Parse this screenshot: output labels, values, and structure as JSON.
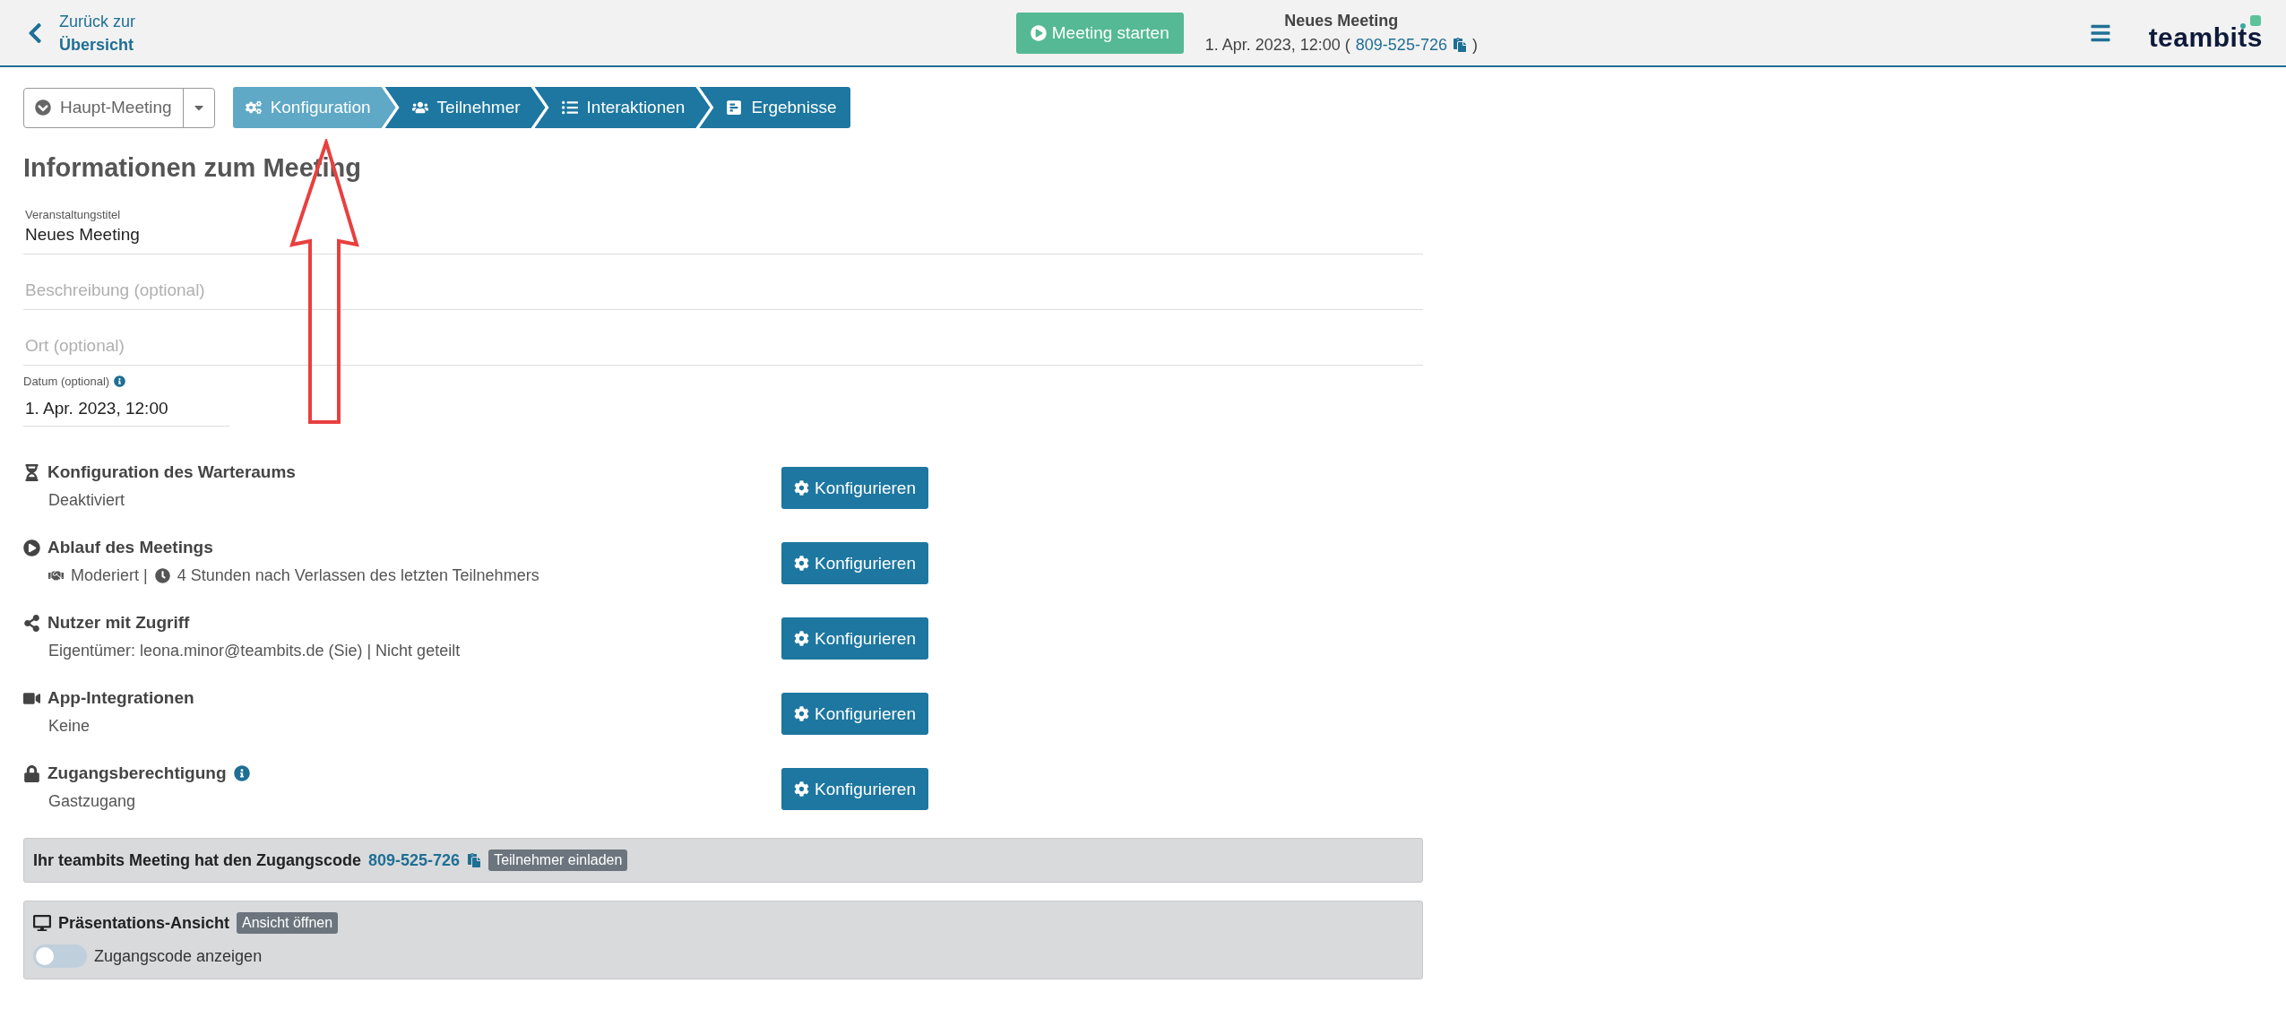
{
  "header": {
    "back_link": {
      "line1": "Zurück zur",
      "line2": "Übersicht"
    },
    "start_button": "Meeting starten",
    "meeting_title": "Neues Meeting",
    "meeting_date": "1. Apr. 2023, 12:00 (",
    "meeting_code": "809-525-726",
    "meeting_code_close": ")",
    "logo": "teambits"
  },
  "meeting_select": {
    "value": "Haupt-Meeting"
  },
  "steps": [
    {
      "label": "Konfiguration",
      "selected": true
    },
    {
      "label": "Teilnehmer",
      "selected": false
    },
    {
      "label": "Interaktionen",
      "selected": false
    },
    {
      "label": "Ergebnisse",
      "selected": false
    }
  ],
  "heading": "Informationen zum Meeting",
  "fields": [
    {
      "label": "Veranstaltungstitel",
      "value": "Neues Meeting"
    },
    {
      "placeholder": "Beschreibung (optional)"
    },
    {
      "placeholder": "Ort (optional)"
    }
  ],
  "date_field": {
    "label": "Datum (optional)",
    "value": "1. Apr. 2023, 12:00"
  },
  "settings": [
    {
      "title": "Konfiguration des Warteraums",
      "info": false,
      "summary": [
        "Deaktiviert"
      ],
      "button": "Konfigurieren"
    },
    {
      "title": "Ablauf des Meetings",
      "info": false,
      "summary": [
        "Moderiert |",
        "4 Stunden nach Verlassen des letzten Teilnehmers"
      ],
      "button": "Konfigurieren"
    },
    {
      "title": "Nutzer mit Zugriff",
      "info": false,
      "summary": [
        "Eigentümer: leona.minor@teambits.de (Sie) | Nicht geteilt"
      ],
      "button": "Konfigurieren"
    },
    {
      "title": "App-Integrationen",
      "info": false,
      "summary": [
        "Keine"
      ],
      "button": "Konfigurieren"
    },
    {
      "title": "Zugangsberechtigung",
      "info": true,
      "summary": [
        "Gastzugang"
      ],
      "button": "Konfigurieren"
    }
  ],
  "access_code_panel": {
    "text": "Ihr teambits Meeting hat den Zugangscode",
    "code": "809-525-726",
    "button": "Teilnehmer einladen"
  },
  "presentation_panel": {
    "title": "Präsentations-Ansicht",
    "button": "Ansicht öffnen",
    "toggle": {
      "label": "Zugangscode anzeigen",
      "on": false
    }
  }
}
